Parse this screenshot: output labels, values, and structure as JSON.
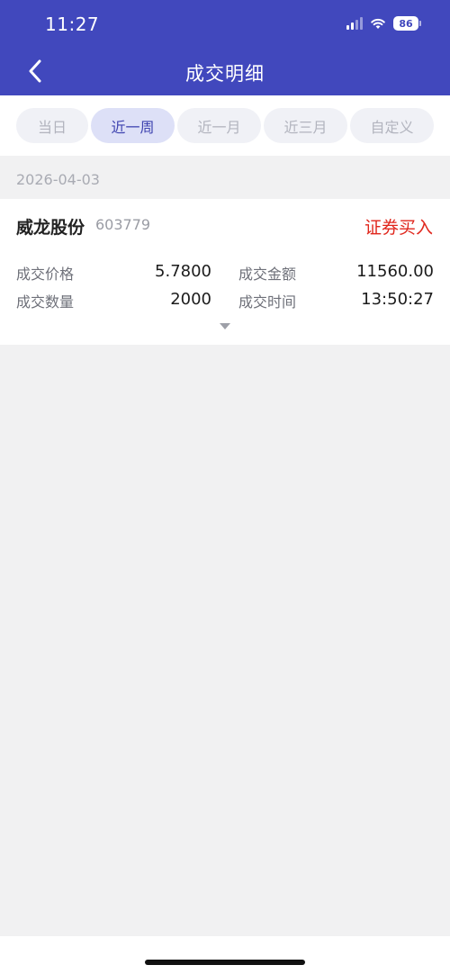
{
  "status_bar": {
    "time": "11:27",
    "battery": "86"
  },
  "nav": {
    "title": "成交明细"
  },
  "tabs": [
    {
      "label": "当日",
      "active": false
    },
    {
      "label": "近一周",
      "active": true
    },
    {
      "label": "近一月",
      "active": false
    },
    {
      "label": "近三月",
      "active": false
    },
    {
      "label": "自定义",
      "active": false
    }
  ],
  "records": [
    {
      "date": "2026-04-03",
      "stock_name": "威龙股份",
      "stock_code": "603779",
      "trade_type": "证券买入",
      "fields": {
        "price_label": "成交价格",
        "price": "5.7800",
        "amount_label": "成交金额",
        "amount": "11560.00",
        "qty_label": "成交数量",
        "qty": "2000",
        "time_label": "成交时间",
        "time": "13:50:27"
      }
    }
  ],
  "colors": {
    "header": "#4148bd",
    "buy": "#e0261c",
    "active_tab": "#dde0f7"
  },
  "icons": {
    "back": "chevron-left-icon",
    "expand": "caret-down-icon"
  }
}
